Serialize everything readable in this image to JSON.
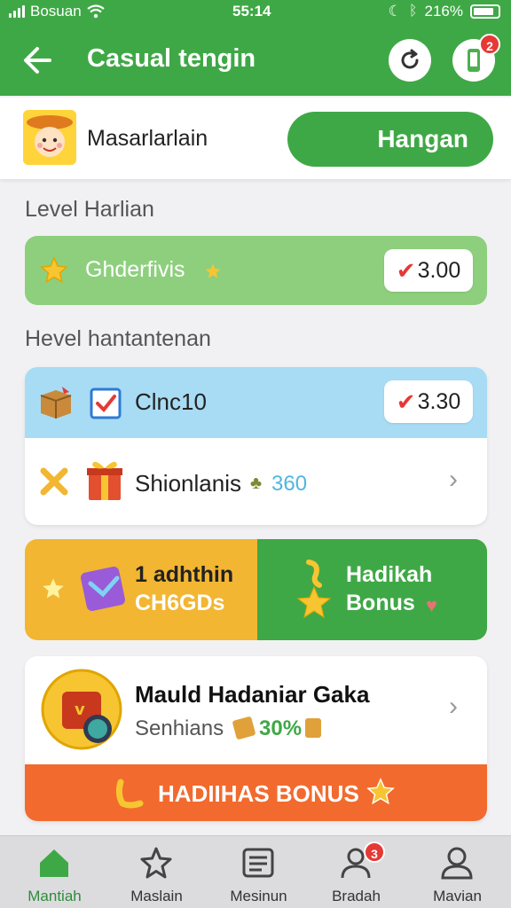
{
  "status": {
    "carrier": "Bosuan",
    "time": "55:14",
    "battery": "216%"
  },
  "appbar": {
    "title": "Casual tengin",
    "notif_count": "2"
  },
  "profile": {
    "name": "Masarlarlain",
    "button": "Hangan"
  },
  "section1": {
    "title": "Level Harlian"
  },
  "green_card": {
    "label": "Ghderfivis",
    "value": "3.00"
  },
  "section2": {
    "title": "Hevel hantantenan"
  },
  "blue_card": {
    "row1": {
      "label": "Clnc10",
      "value": "3.30"
    },
    "row2": {
      "label": "Shionlanis",
      "value": "360"
    }
  },
  "split_card": {
    "left_line1": "1 adhthin",
    "left_line2": "CH6GDs",
    "right_line1": "Hadikah",
    "right_line2": "Bonus"
  },
  "big_card": {
    "title": "Mauld Hadaniar Gaka",
    "sub_label": "Senhians",
    "sub_value": "30%",
    "bar_label": "HADIIHAS BONUS"
  },
  "tabs": [
    {
      "label": "Mantiah",
      "icon": "home-icon"
    },
    {
      "label": "Maslain",
      "icon": "star-outline-icon"
    },
    {
      "label": "Mesinun",
      "icon": "list-icon"
    },
    {
      "label": "Bradah",
      "icon": "user-icon",
      "badge": "3"
    },
    {
      "label": "Mavian",
      "icon": "profile-icon"
    }
  ],
  "colors": {
    "primary": "#3fa846",
    "accent_orange": "#f26a2e",
    "gold": "#f2b632",
    "light_blue": "#a8dcf4"
  }
}
